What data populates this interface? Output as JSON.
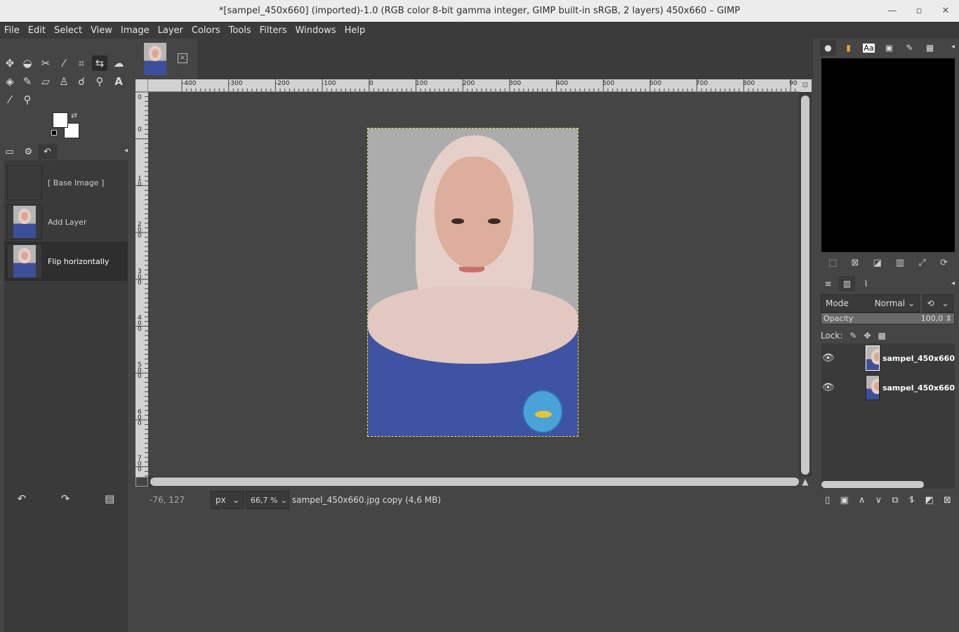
{
  "window": {
    "title": "*[sampel_450x660] (imported)-1.0 (RGB color 8-bit gamma integer, GIMP built-in sRGB, 2 layers) 450x660 – GIMP",
    "minimize_icon": "minimize-icon",
    "maximize_icon": "maximize-icon",
    "close_icon": "close-icon"
  },
  "menu": [
    "File",
    "Edit",
    "Select",
    "View",
    "Image",
    "Layer",
    "Colors",
    "Tools",
    "Filters",
    "Windows",
    "Help"
  ],
  "toolbox": {
    "tools_row1": [
      "move-tool-icon",
      "lasso-select-icon",
      "scissors-select-icon",
      "fuzzy-select-icon",
      "crop-tool-icon",
      "flip-tool-icon",
      "warp-transform-icon"
    ],
    "tools_row2": [
      "bucket-fill-icon",
      "paintbrush-icon",
      "eraser-icon",
      "clone-icon",
      "smudge-icon",
      "paths-icon",
      "text-tool-icon"
    ],
    "tools_row3": [
      "color-picker-icon",
      "zoom-tool-icon"
    ],
    "fg_color": "#ffffff",
    "bg_color": "#ffffff"
  },
  "history": {
    "items": [
      {
        "label": "[ Base Image ]",
        "selected": false
      },
      {
        "label": "Add Layer",
        "selected": false
      },
      {
        "label": "Flip horizontally",
        "selected": true
      }
    ]
  },
  "image_tab": {
    "close_label": "×"
  },
  "rulers": {
    "h_labels": [
      "-400",
      "-300",
      "-200",
      "-100",
      "0",
      "100",
      "200",
      "300",
      "400",
      "500",
      "600",
      "700",
      "800",
      "90"
    ],
    "v_labels": [
      "0",
      "0",
      "1\n0",
      "2\n0\n0",
      "3\n0\n0",
      "4\n0\n0",
      "5\n0\n0",
      "6\n0\n0",
      "7\n0\n0"
    ]
  },
  "status": {
    "coords": "-76, 127",
    "unit": "px",
    "zoom": "66,7 %",
    "message": "sampel_450x660.jpg copy (4,6 MB)"
  },
  "layers_panel": {
    "mode_label": "Mode",
    "mode_value": "Normal",
    "opacity_label": "Opacity",
    "opacity_value": "100,0",
    "opacity_level": 1.0,
    "lock_label": "Lock:",
    "layers": [
      {
        "name": "sampel_450x660",
        "visible": true
      },
      {
        "name": "sampel_450x660",
        "visible": true
      }
    ]
  },
  "brush_tabs": {
    "text_tab": "Aa"
  }
}
